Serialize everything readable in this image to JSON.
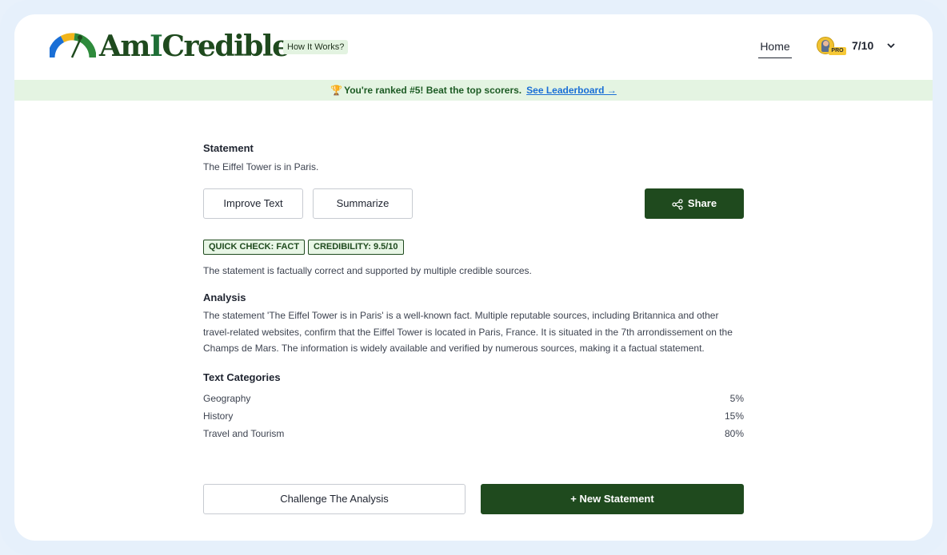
{
  "header": {
    "logo_prefix": "Am",
    "logo_accent": "I",
    "logo_suffix": "Credible",
    "how_it_works": "How It Works?",
    "nav_home": "Home",
    "user_badge": "PRO",
    "score": "7/10"
  },
  "banner": {
    "icon": "trophy-icon",
    "text": "You're ranked #5! Beat the top scorers.",
    "link": "See Leaderboard →"
  },
  "statement": {
    "heading": "Statement",
    "text": "The Eiffel Tower is in Paris."
  },
  "actions": {
    "improve": "Improve Text",
    "summarize": "Summarize",
    "share": "Share"
  },
  "badges": {
    "quick_check": "QUICK CHECK: FACT",
    "credibility": "CREDIBILITY: 9.5/10"
  },
  "verdict": "The statement is factually correct and supported by multiple credible sources.",
  "analysis": {
    "heading": "Analysis",
    "text": "The statement 'The Eiffel Tower is in Paris' is a well-known fact. Multiple reputable sources, including Britannica and other travel-related websites, confirm that the Eiffel Tower is located in Paris, France. It is situated in the 7th arrondissement on the Champs de Mars. The information is widely available and verified by numerous sources, making it a factual statement."
  },
  "categories": {
    "heading": "Text Categories",
    "items": [
      {
        "name": "Geography",
        "percent": "5%"
      },
      {
        "name": "History",
        "percent": "15%"
      },
      {
        "name": "Travel and Tourism",
        "percent": "80%"
      }
    ]
  },
  "footer": {
    "challenge": "Challenge The Analysis",
    "new_statement": "+ New Statement"
  },
  "colors": {
    "brand_dark_green": "#1f4a1e",
    "banner_bg": "#e4f4e2",
    "link_blue": "#1a6fd6",
    "frame_bg": "#e6f0fb"
  }
}
